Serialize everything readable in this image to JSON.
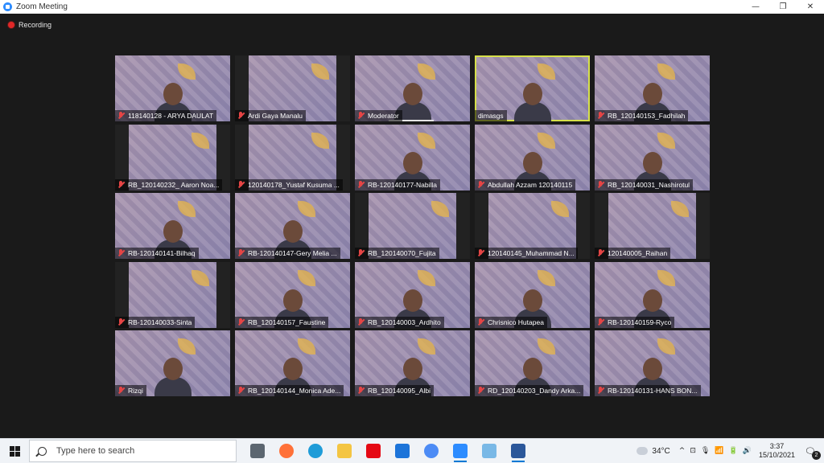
{
  "window": {
    "title": "Zoom Meeting",
    "controls": {
      "minimize": "—",
      "restore": "❐",
      "close": "✕"
    }
  },
  "meeting": {
    "recording_label": "Recording",
    "participants": [
      {
        "name": "118140128 - ARYA DAULAT",
        "muted": true,
        "video": true
      },
      {
        "name": "Ardi Gaya Manalu",
        "muted": true,
        "video": false
      },
      {
        "name": "Moderator",
        "muted": true,
        "video": true,
        "speaking": true
      },
      {
        "name": "dimasgs",
        "muted": false,
        "video": true,
        "active_speaker": true
      },
      {
        "name": "RB_120140153_Fadhilah",
        "muted": true,
        "video": true
      },
      {
        "name": "RB_120140232_ Aaron Noa...",
        "muted": true,
        "video": false
      },
      {
        "name": "120140178_Yustaf Kusuma ...",
        "muted": true,
        "video": false
      },
      {
        "name": "RB-120140177-Nabilla",
        "muted": true,
        "video": true
      },
      {
        "name": "Abdullah Azzam 120140115",
        "muted": true,
        "video": true
      },
      {
        "name": "RB_120140031_Nashirotul",
        "muted": true,
        "video": true
      },
      {
        "name": "RB-120140141-Bilhaq",
        "muted": true,
        "video": true
      },
      {
        "name": "RB-120140147-Gery Melia ...",
        "muted": true,
        "video": true
      },
      {
        "name": "RB_120140070_Fujita",
        "muted": true,
        "video": false
      },
      {
        "name": "120140145_Muhammad N...",
        "muted": true,
        "video": false
      },
      {
        "name": "120140005_Raihan",
        "muted": true,
        "video": false
      },
      {
        "name": "RB-120140033-Sinta",
        "muted": true,
        "video": false
      },
      {
        "name": "RB_120140157_Faustine",
        "muted": true,
        "video": true
      },
      {
        "name": "RB_120140003_Ardhito",
        "muted": true,
        "video": true
      },
      {
        "name": "Chrisnico Hutapea",
        "muted": true,
        "video": true
      },
      {
        "name": "RB-120140159-Ryco",
        "muted": true,
        "video": true
      },
      {
        "name": "Rizqi",
        "muted": true,
        "video": true
      },
      {
        "name": "RB_120140144_Monica Ade...",
        "muted": true,
        "video": true
      },
      {
        "name": "RB_120140095_Albi",
        "muted": true,
        "video": true
      },
      {
        "name": "RD_120140203_Dandy Arka...",
        "muted": true,
        "video": true
      },
      {
        "name": "RB-120140131-HANS BON...",
        "muted": true,
        "video": true
      }
    ]
  },
  "taskbar": {
    "search_placeholder": "Type here to search",
    "apps": [
      {
        "name": "task-view",
        "color": "#5c6670",
        "open": false
      },
      {
        "name": "firefox",
        "color": "#ff7139",
        "open": false
      },
      {
        "name": "edge",
        "color": "#1f9cd8",
        "open": false
      },
      {
        "name": "file-explorer",
        "color": "#f4c542",
        "open": false
      },
      {
        "name": "netflix",
        "color": "#e50914",
        "open": false
      },
      {
        "name": "mail",
        "color": "#1c74d9",
        "open": false
      },
      {
        "name": "chrome",
        "color": "#4c8bf5",
        "open": false
      },
      {
        "name": "zoom",
        "color": "#2d8cff",
        "open": true
      },
      {
        "name": "photos",
        "color": "#79b8e6",
        "open": false
      },
      {
        "name": "word",
        "color": "#2b579a",
        "open": true
      }
    ],
    "temperature": "34°C",
    "tray_icons": [
      "^",
      "⊡",
      "🎙",
      "📶",
      "🔋",
      "🔊"
    ],
    "time": "3:37",
    "date": "15/10/2021",
    "notification_count": "2"
  }
}
